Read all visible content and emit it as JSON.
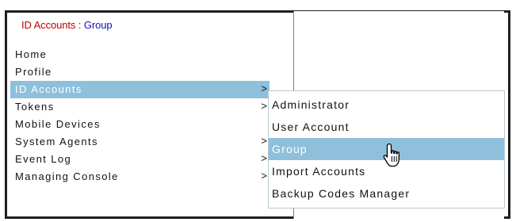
{
  "breadcrumb": {
    "section": "ID Accounts",
    "separator": " : ",
    "page": "Group"
  },
  "menu": {
    "items": [
      {
        "label": "Home",
        "has_submenu": false
      },
      {
        "label": "Profile",
        "has_submenu": false
      },
      {
        "label": "ID Accounts",
        "has_submenu": true,
        "active": true
      },
      {
        "label": "Tokens",
        "has_submenu": true
      },
      {
        "label": "Mobile Devices",
        "has_submenu": false
      },
      {
        "label": "System Agents",
        "has_submenu": true
      },
      {
        "label": "Event Log",
        "has_submenu": true
      },
      {
        "label": "Managing Console",
        "has_submenu": true
      }
    ],
    "arrow_glyph": ">"
  },
  "submenu": {
    "items": [
      {
        "label": "Administrator"
      },
      {
        "label": "User Account"
      },
      {
        "label": "Group",
        "active": true
      },
      {
        "label": "Import Accounts"
      },
      {
        "label": "Backup Codes Manager"
      }
    ]
  },
  "cursor": {
    "icon": "hand-pointer-icon"
  },
  "colors": {
    "highlight": "#8ec0dc",
    "breadcrumb_section": "#c00000",
    "breadcrumb_page": "#1414b4",
    "frame": "#1f1f1f"
  }
}
